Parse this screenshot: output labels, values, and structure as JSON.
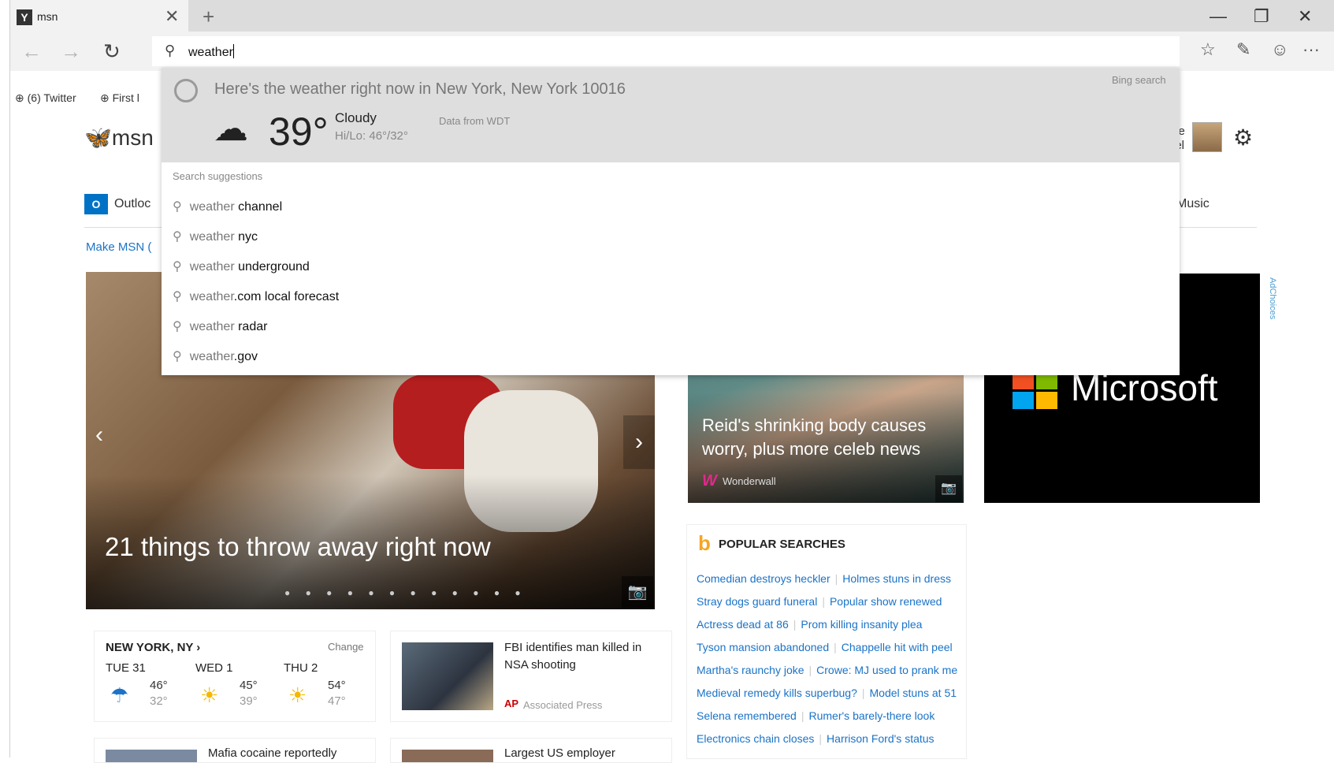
{
  "tab": {
    "icon": "Y",
    "title": "msn",
    "close": "✕",
    "new": "+"
  },
  "window_controls": {
    "minimize": "—",
    "restore": "❐",
    "close": "✕"
  },
  "nav": {
    "back": "←",
    "forward": "→",
    "refresh": "↻"
  },
  "address_bar": {
    "search_icon": "⚲",
    "value": "weather"
  },
  "toolbar": {
    "reading": "☆",
    "note": "✎",
    "feedback": "☺",
    "more": "···"
  },
  "favorites": [
    {
      "label": "(6) Twitter"
    },
    {
      "label": "First l"
    }
  ],
  "msn": {
    "logo": "msn",
    "me_line1": "me",
    "me_line2": "ael",
    "outlook_icon": "O",
    "outlook_label": "Outloc",
    "music_label": "Music",
    "make_msn": "Make MSN ("
  },
  "dropdown": {
    "weather_heading": "Here's the weather right now in New York, New York 10016",
    "bing_search": "Bing search",
    "temp": "39°",
    "condition": "Cloudy",
    "hilo": "Hi/Lo: 46°/32°",
    "data_source": "Data from WDT",
    "suggestions_heading": "Search suggestions",
    "suggestions": [
      {
        "prefix": "weather",
        "suffix": " channel"
      },
      {
        "prefix": "weather",
        "suffix": " nyc"
      },
      {
        "prefix": "weather",
        "suffix": " underground"
      },
      {
        "prefix": "weather",
        "suffix": ".com local forecast"
      },
      {
        "prefix": "weather",
        "suffix": " radar"
      },
      {
        "prefix": "weather",
        "suffix": ".gov"
      }
    ]
  },
  "hero": {
    "title": "21 things to throw away right now",
    "dots": "● ● ● ● ● ● ● ● ● ● ● ●"
  },
  "celeb": {
    "title": "Reid's shrinking body causes worry, plus more celeb news",
    "source": "Wonderwall",
    "source_mark": "W"
  },
  "ad": {
    "brand": "Microsoft",
    "adchoices": "AdChoices",
    "colors": [
      "#f25022",
      "#7fba00",
      "#00a4ef",
      "#ffb900"
    ]
  },
  "popular": {
    "heading": "POPULAR SEARCHES",
    "rows": [
      [
        "Comedian destroys heckler",
        "Holmes stuns in dress"
      ],
      [
        "Stray dogs guard funeral",
        "Popular show renewed"
      ],
      [
        "Actress dead at 86",
        "Prom killing insanity plea"
      ],
      [
        "Tyson mansion abandoned",
        "Chappelle hit with peel"
      ],
      [
        "Martha's raunchy joke",
        "Crowe: MJ used to prank me"
      ],
      [
        "Medieval remedy kills superbug?",
        "Model stuns at 51"
      ],
      [
        "Selena remembered",
        "Rumer's barely-there look"
      ],
      [
        "Electronics chain closes",
        "Harrison Ford's status"
      ]
    ]
  },
  "weather_card": {
    "city": "NEW YORK, NY ›",
    "change": "Change",
    "days": [
      {
        "name": "TUE 31",
        "icon": "☂",
        "hi": "46°",
        "lo": "32°"
      },
      {
        "name": "WED 1",
        "icon": "☀",
        "hi": "45°",
        "lo": "39°"
      },
      {
        "name": "THU 2",
        "icon": "☀",
        "hi": "54°",
        "lo": "47°"
      }
    ]
  },
  "news1": {
    "title": "FBI identifies man killed in NSA shooting",
    "source_mark": "AP",
    "source": "Associated Press"
  },
  "news2": {
    "title": "Mafia cocaine reportedly"
  },
  "news3": {
    "title": "Largest US employer"
  }
}
